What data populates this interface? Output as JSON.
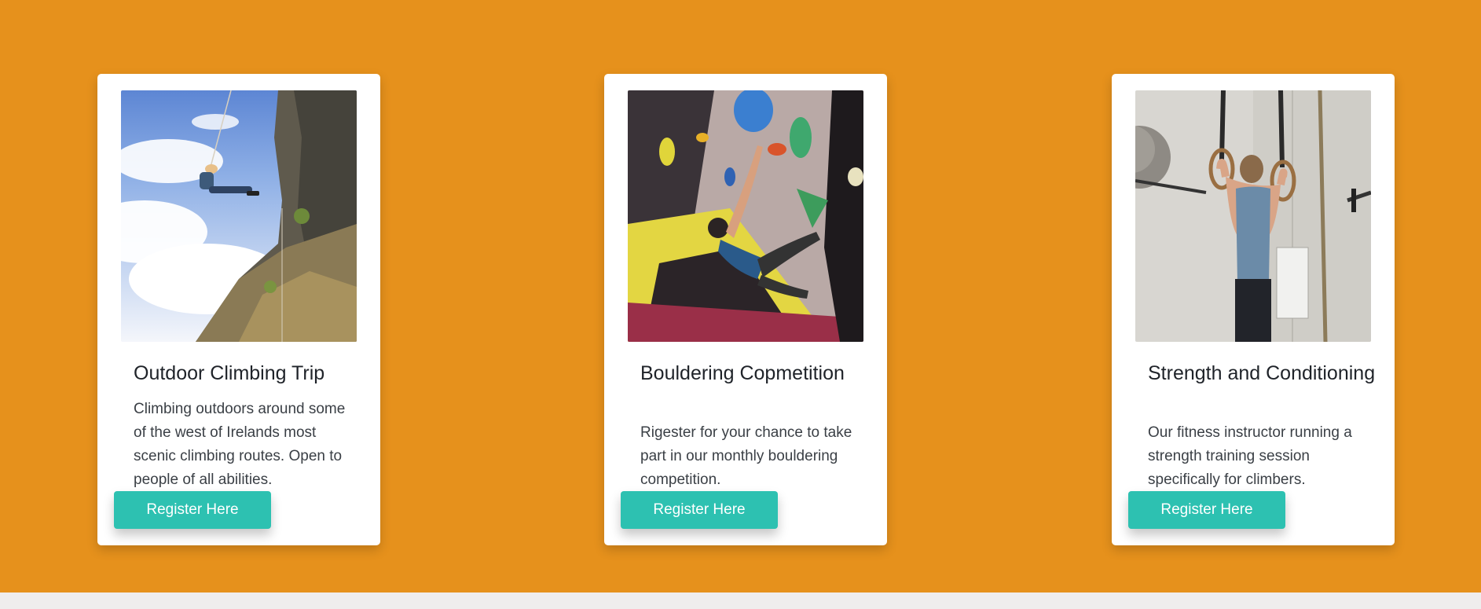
{
  "cards": [
    {
      "title": "Outdoor Climbing Trip",
      "description": "Climbing outdoors around some of the west of Irelands most scenic climbing routes. Open to people of all abilities.",
      "button_label": "Register Here",
      "image": "outdoor-climbing-photo"
    },
    {
      "title": "Bouldering Copmetition",
      "description": "Rigester for your chance to take part in our monthly bouldering competition.",
      "button_label": "Register Here",
      "image": "bouldering-photo"
    },
    {
      "title": "Strength and Conditioning",
      "description": "Our fitness instructor running a strength training session specifically for climbers.",
      "button_label": "Register Here",
      "image": "gym-rings-photo"
    }
  ],
  "colors": {
    "band_background": "#e6911c",
    "page_background": "#efeded",
    "button": "#2dc1b1",
    "card": "#ffffff"
  }
}
